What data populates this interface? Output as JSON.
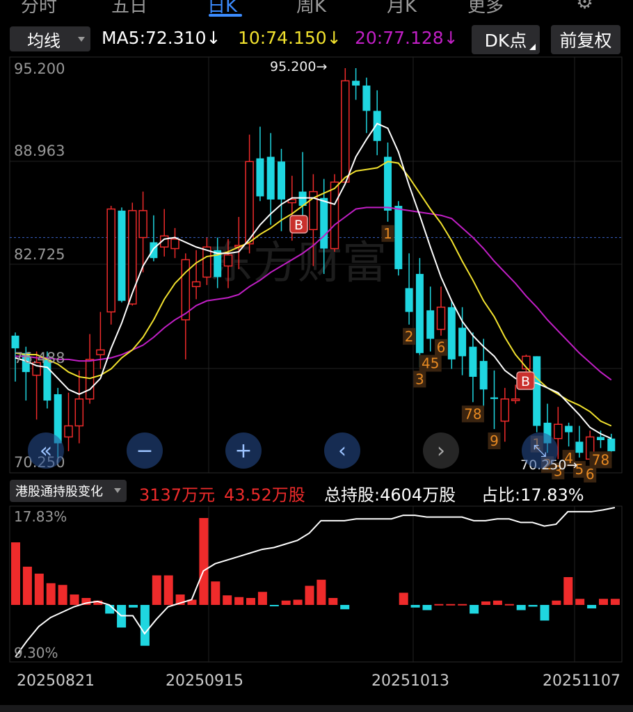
{
  "top_tabs": [
    "分时",
    "五日",
    "日K",
    "周K",
    "月K",
    "更多"
  ],
  "active_tab": "日K",
  "toolbar": {
    "ma_select": "均线",
    "ma5": "MA5:72.310↓",
    "ma10": "10:74.150↓",
    "ma20": "20:77.128↓",
    "dk_button": "DK点",
    "adjust_button": "前复权"
  },
  "colors": {
    "up": "#ef2b2b",
    "down": "#1fd6e0",
    "ma5": "#ffffff",
    "ma10": "#f2e22e",
    "ma20": "#c21fc6",
    "accent": "#3c8cff",
    "signal": "#e88a22"
  },
  "price_axis": {
    "labels": [
      "95.200",
      "88.963",
      "82.725",
      "76.488",
      "70.250"
    ]
  },
  "price_marks": {
    "high": "95.200→",
    "low": "70.250→",
    "buy_label": "B"
  },
  "signals": [
    "1",
    "2",
    "3",
    "6",
    "45",
    "78",
    "9",
    "1",
    "2",
    "3",
    "4",
    "5",
    "6",
    "78"
  ],
  "hk_bar": {
    "select": "港股通持股变化",
    "change_value": "3137万元",
    "change_shares": "43.52万股",
    "total": "总持股:4604万股",
    "ratio": "占比:17.83%"
  },
  "hk_axis": {
    "top": "17.83%",
    "bottom": "9.30%"
  },
  "date_axis": [
    "20250821",
    "20250915",
    "20251013",
    "20251107"
  ],
  "watermark": "东方财富",
  "chart_data": {
    "type": "candlestick",
    "title": "",
    "y_range": [
      70.25,
      95.2
    ],
    "reference_line": 84.5,
    "candles": [
      [
        78.3,
        77.5,
        78.5,
        75.4
      ],
      [
        77.2,
        76.0,
        77.6,
        74.2
      ],
      [
        75.8,
        76.6,
        77.3,
        73.0
      ],
      [
        76.8,
        74.2,
        77.3,
        73.7
      ],
      [
        74.6,
        71.5,
        75.0,
        70.3
      ],
      [
        71.9,
        72.6,
        74.7,
        71.0
      ],
      [
        72.6,
        74.3,
        76.1,
        71.5
      ],
      [
        74.3,
        76.8,
        78.4,
        74.0
      ],
      [
        77.1,
        77.4,
        79.8,
        76.2
      ],
      [
        79.8,
        86.3,
        86.5,
        79.0
      ],
      [
        86.2,
        80.5,
        86.4,
        80.4
      ],
      [
        80.3,
        86.2,
        86.7,
        80.2
      ],
      [
        84.5,
        86.2,
        87.4,
        82.3
      ],
      [
        84.2,
        83.2,
        85.9,
        83.0
      ],
      [
        83.9,
        84.6,
        86.3,
        83.3
      ],
      [
        83.8,
        84.4,
        85.1,
        83.2
      ],
      [
        79.3,
        83.1,
        83.5,
        76.8
      ],
      [
        81.4,
        81.7,
        83.7,
        80.6
      ],
      [
        82.0,
        83.9,
        84.5,
        81.5
      ],
      [
        83.7,
        82.0,
        84.5,
        81.3
      ],
      [
        82.7,
        83.4,
        84.4,
        81.3
      ],
      [
        83.9,
        84.0,
        85.8,
        82.5
      ],
      [
        84.1,
        89.3,
        91.0,
        83.5
      ],
      [
        89.5,
        87.1,
        91.5,
        86.8
      ],
      [
        89.6,
        86.9,
        91.1,
        85.3
      ],
      [
        89.3,
        86.9,
        90.1,
        84.9
      ],
      [
        86.7,
        86.9,
        88.4,
        84.3
      ],
      [
        87.4,
        86.5,
        89.9,
        85.5
      ],
      [
        85.0,
        87.4,
        88.5,
        82.7
      ],
      [
        87.0,
        83.8,
        88.2,
        82.2
      ],
      [
        83.8,
        88.0,
        88.5,
        83.6
      ],
      [
        88.0,
        94.4,
        95.2,
        87.9
      ],
      [
        94.4,
        94.1,
        95.2,
        93.2
      ],
      [
        94.1,
        92.5,
        94.6,
        91.1
      ],
      [
        92.5,
        90.6,
        93.8,
        89.7
      ],
      [
        89.6,
        86.2,
        90.5,
        85.5
      ],
      [
        86.5,
        82.5,
        86.8,
        82.1
      ],
      [
        81.3,
        79.8,
        83.5,
        79.0
      ],
      [
        82.2,
        77.2,
        83.2,
        76.3
      ],
      [
        79.9,
        78.1,
        81.4,
        77.3
      ],
      [
        78.7,
        80.1,
        81.4,
        78.3
      ],
      [
        80.1,
        76.8,
        80.5,
        76.2
      ],
      [
        78.8,
        77.0,
        80.1,
        75.8
      ],
      [
        77.6,
        75.7,
        78.5,
        74.1
      ],
      [
        76.7,
        74.9,
        78.1,
        73.8
      ],
      [
        74.4,
        74.3,
        76.1,
        72.4
      ],
      [
        72.9,
        74.3,
        75.0,
        71.6
      ],
      [
        74.2,
        74.3,
        75.2,
        74.0
      ],
      [
        76.2,
        77.0,
        77.1,
        75.2
      ],
      [
        77.0,
        72.6,
        77.0,
        72.2
      ],
      [
        72.8,
        71.5,
        74.0,
        70.9
      ],
      [
        71.8,
        72.7,
        73.8,
        70.5
      ],
      [
        72.6,
        72.2,
        72.8,
        71.3
      ],
      [
        71.6,
        70.9,
        72.6,
        70.6
      ],
      [
        70.5,
        71.9,
        72.3,
        70.3
      ],
      [
        71.9,
        71.7,
        72.3,
        71.2
      ],
      [
        71.8,
        71.0,
        72.1,
        70.6
      ]
    ],
    "ma5": [
      76.9,
      76.7,
      76.4,
      76.3,
      75.6,
      74.9,
      74.6,
      74.9,
      75.6,
      77.5,
      79.1,
      81.0,
      82.7,
      83.8,
      84.4,
      84.5,
      84.2,
      83.9,
      83.7,
      83.5,
      83.5,
      83.6,
      84.4,
      85.3,
      86.0,
      86.6,
      87.0,
      87.0,
      87.0,
      86.8,
      86.6,
      87.9,
      89.6,
      90.7,
      91.7,
      91.4,
      89.9,
      87.8,
      85.9,
      83.9,
      82.0,
      80.5,
      79.2,
      78.3,
      77.6,
      77.0,
      76.1,
      75.6,
      75.4,
      75.3,
      75.0,
      74.7,
      74.0,
      73.3,
      72.5,
      72.1,
      71.8
    ],
    "ma10": [
      77.2,
      77.1,
      77.1,
      76.8,
      76.5,
      76.0,
      75.7,
      75.6,
      75.8,
      76.2,
      76.9,
      77.4,
      78.2,
      79.3,
      80.6,
      81.6,
      82.3,
      82.9,
      83.3,
      83.4,
      83.6,
      83.9,
      84.2,
      84.7,
      85.1,
      85.6,
      86.0,
      86.5,
      87.0,
      87.3,
      87.6,
      88.3,
      88.7,
      88.8,
      88.9,
      89.3,
      89.2,
      88.3,
      87.3,
      86.3,
      85.4,
      84.3,
      83.0,
      81.8,
      80.5,
      79.5,
      78.2,
      77.1,
      76.3,
      75.6,
      75.0,
      74.6,
      74.2,
      73.9,
      73.5,
      72.9,
      72.6
    ],
    "ma20": [
      77.0,
      77.0,
      76.9,
      76.9,
      76.8,
      76.8,
      76.7,
      76.7,
      76.8,
      76.9,
      77.1,
      77.4,
      77.7,
      78.2,
      78.8,
      79.3,
      79.7,
      80.2,
      80.5,
      80.6,
      80.7,
      80.9,
      81.4,
      81.8,
      82.3,
      82.7,
      83.1,
      83.5,
      84.0,
      84.6,
      85.3,
      85.8,
      86.3,
      86.4,
      86.4,
      86.4,
      86.3,
      86.2,
      86.1,
      86.0,
      85.9,
      85.7,
      85.1,
      84.5,
      83.8,
      83.0,
      82.3,
      81.6,
      80.8,
      80.1,
      79.3,
      78.6,
      77.9,
      77.2,
      76.6,
      76.0,
      75.5
    ],
    "hk_flow": [
      7.2,
      4.4,
      3.6,
      2.5,
      2.3,
      1.2,
      0.8,
      0.5,
      -1.0,
      -2.6,
      -0.3,
      -4.7,
      3.4,
      3.4,
      1.2,
      0.6,
      10.0,
      2.7,
      1.1,
      0.9,
      0.8,
      1.5,
      -0.1,
      0.5,
      0.6,
      2.2,
      2.9,
      0.8,
      -0.5,
      0,
      0,
      0,
      0,
      1.4,
      -0.3,
      -0.6,
      0.1,
      0.1,
      0.1,
      -1.0,
      0.4,
      0.5,
      0.1,
      -0.6,
      -0.2,
      -1.8,
      0.5,
      3.2,
      0.7,
      -0.4,
      0.7,
      0.7
    ],
    "hk_ratio": [
      9.5,
      10.4,
      11.2,
      11.7,
      12.0,
      12.3,
      12.5,
      12.6,
      12.4,
      11.8,
      11.8,
      10.8,
      11.6,
      12.3,
      12.5,
      12.7,
      14.3,
      14.7,
      14.9,
      15.1,
      15.3,
      15.5,
      15.6,
      15.8,
      16.0,
      16.4,
      17.1,
      17.1,
      17.1,
      17.2,
      17.2,
      17.2,
      17.2,
      17.4,
      17.4,
      17.3,
      17.3,
      17.3,
      17.3,
      17.1,
      17.1,
      17.2,
      17.2,
      17.0,
      17.0,
      16.8,
      16.9,
      17.6,
      17.6,
      17.6,
      17.7,
      17.83
    ]
  }
}
